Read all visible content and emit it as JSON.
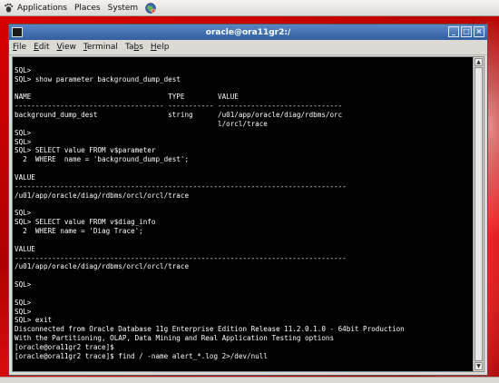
{
  "top_panel": {
    "applications": "Applications",
    "places": "Places",
    "system": "System"
  },
  "window": {
    "title": "oracle@ora11gr2:/",
    "menus": [
      {
        "prefix": "",
        "key": "F",
        "rest": "ile"
      },
      {
        "prefix": "",
        "key": "E",
        "rest": "dit"
      },
      {
        "prefix": "",
        "key": "V",
        "rest": "iew"
      },
      {
        "prefix": "",
        "key": "T",
        "rest": "erminal"
      },
      {
        "prefix": "Ta",
        "key": "b",
        "rest": "s"
      },
      {
        "prefix": "",
        "key": "H",
        "rest": "elp"
      }
    ],
    "buttons": {
      "minimize": "_",
      "maximize": "□",
      "close": "×"
    }
  },
  "terminal": {
    "lines": [
      "",
      "SQL>",
      "SQL> show parameter background_dump_dest",
      "",
      "NAME                                 TYPE        VALUE",
      "------------------------------------ ----------- ------------------------------",
      "background_dump_dest                 string      /u01/app/oracle/diag/rdbms/orc",
      "                                                 l/orcl/trace",
      "SQL>",
      "SQL>",
      "SQL> SELECT value FROM v$parameter",
      "  2  WHERE  name = 'background_dump_dest';",
      "",
      "VALUE",
      "--------------------------------------------------------------------------------",
      "/u01/app/oracle/diag/rdbms/orcl/orcl/trace",
      "",
      "SQL>",
      "SQL> SELECT value FROM v$diag_info",
      "  2  WHERE name = 'Diag Trace';",
      "",
      "VALUE",
      "--------------------------------------------------------------------------------",
      "/u01/app/oracle/diag/rdbms/orcl/orcl/trace",
      "",
      "SQL>",
      "",
      "SQL>",
      "SQL>",
      "SQL> exit",
      "Disconnected from Oracle Database 11g Enterprise Edition Release 11.2.0.1.0 - 64bit Production",
      "With the Partitioning, OLAP, Data Mining and Real Application Testing options",
      "[oracle@ora11gr2 trace]$",
      "[oracle@ora11gr2 trace]$ find / -name alert_*.log 2>/dev/null"
    ]
  },
  "colors": {
    "terminal_bg": "#000000",
    "terminal_fg": "#ffffff",
    "titlebar": "#3f6dae",
    "desktop": "#c40000"
  }
}
